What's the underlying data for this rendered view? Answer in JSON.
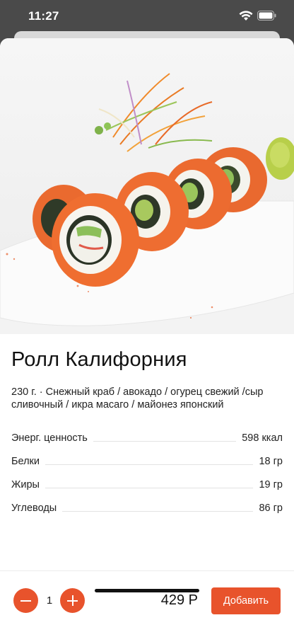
{
  "status_bar": {
    "time": "11:27",
    "icons": [
      "wifi-icon",
      "battery-icon"
    ]
  },
  "product": {
    "image": "sushi-roll-photo",
    "title": "Ролл Калифорния",
    "description": "230 г. · Снежный краб / авокадо / огурец свежий /сыр сливочный / икра масаго / майонез японский",
    "nutrition": [
      {
        "label": "Энерг. ценность",
        "value": "598 ккал"
      },
      {
        "label": "Белки",
        "value": "18 гр"
      },
      {
        "label": "Жиры",
        "value": "19 гр"
      },
      {
        "label": "Углеводы",
        "value": "86 гр"
      }
    ]
  },
  "footer": {
    "quantity": "1",
    "price": "429 Р",
    "add_label": "Добавить"
  },
  "colors": {
    "accent": "#e8532c",
    "status_bar_bg": "#4a4a4a"
  }
}
